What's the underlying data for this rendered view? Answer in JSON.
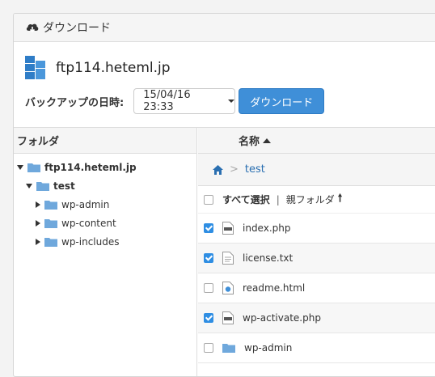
{
  "panel": {
    "title": "ダウンロード",
    "icon": "cloud-download-icon"
  },
  "server": {
    "host": "ftp114.heteml.jp",
    "icon": "server-icon"
  },
  "backup": {
    "label": "バックアップの日時:",
    "selected_datetime": "15/04/16 23:33",
    "download_button": "ダウンロード"
  },
  "folder_pane": {
    "header": "フォルダ",
    "tree": [
      {
        "label": "ftp114.heteml.jp",
        "expanded": true,
        "bold": true,
        "depth": 0
      },
      {
        "label": "test",
        "expanded": true,
        "bold": true,
        "depth": 1
      },
      {
        "label": "wp-admin",
        "expanded": false,
        "bold": false,
        "depth": 2
      },
      {
        "label": "wp-content",
        "expanded": false,
        "bold": false,
        "depth": 2
      },
      {
        "label": "wp-includes",
        "expanded": false,
        "bold": false,
        "depth": 2
      }
    ]
  },
  "list_pane": {
    "header": "名称",
    "breadcrumb": {
      "separator": ">",
      "current": "test"
    },
    "select_all": "すべて選択",
    "divider": "|",
    "parent_folder": "親フォルダ",
    "parent_arrow": "🠕",
    "files": [
      {
        "name": "index.php",
        "checked": true,
        "icon": "php-file-icon"
      },
      {
        "name": "license.txt",
        "checked": true,
        "icon": "text-file-icon"
      },
      {
        "name": "readme.html",
        "checked": false,
        "icon": "html-file-icon"
      },
      {
        "name": "wp-activate.php",
        "checked": true,
        "icon": "php-file-icon"
      },
      {
        "name": "wp-admin",
        "checked": false,
        "icon": "folder-icon"
      }
    ]
  },
  "colors": {
    "accent": "#3f8fd8",
    "link": "#2a6fb1",
    "folder": "#6fa8dc"
  }
}
